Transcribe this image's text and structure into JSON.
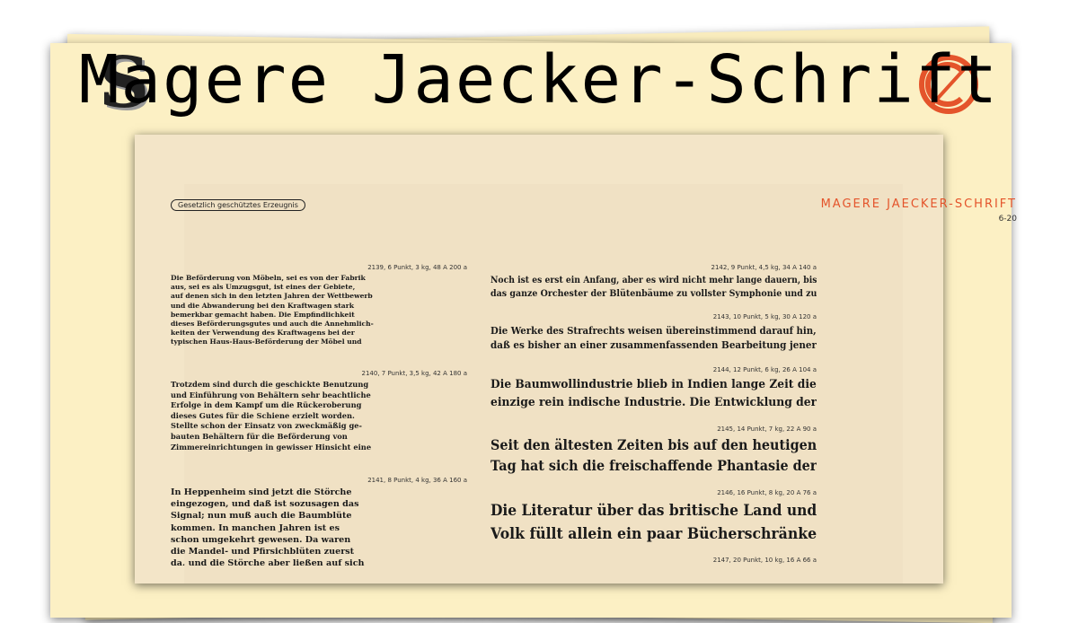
{
  "title": "Magere Jaecker-Schrift",
  "logo_left": {
    "glyph": "S"
  },
  "logo_right": {
    "name": "red-c-seal-icon",
    "color": "#e4542b"
  },
  "page": {
    "badge": "Gesetzlich geschütztes Erzeugnis",
    "heading": "MAGERE JAECKER-SCHRIFT",
    "sheet_number": "6-20",
    "accent_color": "#e4542b"
  },
  "left_specimens": [
    {
      "label": "2139, 6 Punkt, 3 kg, 48 A 200 a",
      "lines": [
        "Die Beförderung von Möbeln, sei es von der Fabrik",
        "aus, sei es als Umzugsgut, ist eines der Gebiete,",
        "auf denen sich in den letzten Jahren der Wettbewerb",
        "und die Abwanderung bei den Kraftwagen stark",
        "bemerkbar gemacht haben. Die Empfindlichkeit",
        "dieses Beförderungsgutes und auch die Annehmlich-",
        "keiten der Verwendung des Kraftwagens bei der",
        "typischen Haus-Haus-Beförderung der Möbel und"
      ]
    },
    {
      "label": "2140, 7 Punkt, 3,5 kg, 42 A 180 a",
      "lines": [
        "Trotzdem sind durch die geschickte Benutzung",
        "und Einführung von Behältern sehr beachtliche",
        "Erfolge in dem Kampf um die Rückeroberung",
        "dieses Gutes für die Schiene erzielt worden.",
        "Stellte schon der Einsatz von zweckmäßig ge-",
        "bauten Behältern für die Beförderung von",
        "Zimmereinrichtungen in gewisser Hinsicht eine"
      ]
    },
    {
      "label": "2141, 8 Punkt, 4 kg, 36 A 160 a",
      "lines": [
        "In Heppenheim sind jetzt die Störche",
        "eingezogen, und daß ist sozusagen das",
        "Signal; nun muß auch die Baumblüte",
        "kommen. In manchen Jahren ist es",
        "schon umgekehrt gewesen. Da waren",
        "die Mandel- und Pfirsichblüten zuerst",
        "da, und die Störche aber ließen auf sich"
      ]
    }
  ],
  "right_specimens": [
    {
      "label": "2142, 9 Punkt, 4,5 kg, 34 A 140 a",
      "lines": [
        "Noch ist es erst ein Anfang, aber es wird nicht mehr lange dauern, bis",
        "das ganze Orchester der Blütenbäume zu vollster Symphonie und zu"
      ]
    },
    {
      "label": "2143, 10 Punkt, 5 kg, 30 A 120 a",
      "lines": [
        "Die Werke des Strafrechts weisen übereinstimmend darauf hin,",
        "daß es bisher an einer zusammenfassenden Bearbeitung jener"
      ]
    },
    {
      "label": "2144, 12 Punkt, 6 kg, 26 A 104 a",
      "lines": [
        "Die Baumwollindustrie blieb in Indien lange Zeit die",
        "einzige rein indische Industrie. Die Entwicklung der"
      ]
    },
    {
      "label": "2145, 14 Punkt, 7 kg, 22 A 90 a",
      "lines": [
        "Seit den ältesten Zeiten bis auf den heutigen",
        "Tag hat sich die freischaffende Phantasie der"
      ]
    },
    {
      "label": "2146, 16 Punkt, 8 kg, 20 A 76 a",
      "lines": [
        "Die Literatur über das britische Land und",
        "Volk füllt allein ein paar Bücherschränke"
      ]
    },
    {
      "label": "2147, 20 Punkt, 10 kg, 16 A 66 a",
      "lines": []
    }
  ]
}
